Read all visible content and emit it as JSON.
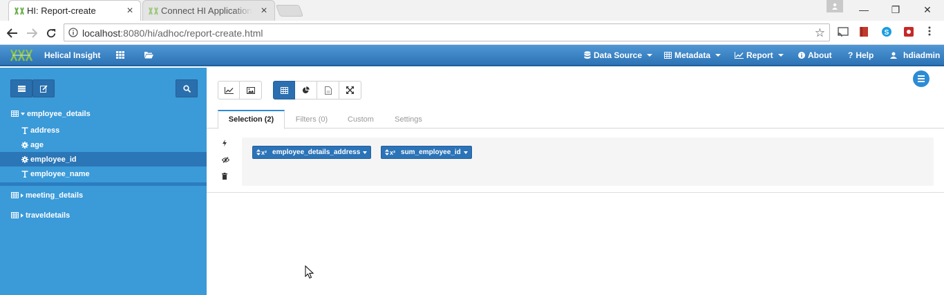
{
  "browser": {
    "tabs": [
      {
        "title": "HI: Report-create",
        "active": true
      },
      {
        "title": "Connect HI Application w",
        "active": false
      }
    ],
    "url_host": "localhost",
    "url_rest": ":8080/hi/adhoc/report-create.html",
    "controls": {
      "minimize": "—",
      "restore": "❐",
      "close": "✕"
    }
  },
  "appbar": {
    "brand": "Helical Insight",
    "menu": [
      {
        "label": "Data Source",
        "icon": "database-icon",
        "dropdown": true
      },
      {
        "label": "Metadata",
        "icon": "table-icon",
        "dropdown": true
      },
      {
        "label": "Report",
        "icon": "line-chart-icon",
        "dropdown": true
      },
      {
        "label": "About",
        "icon": "info-icon",
        "dropdown": false
      },
      {
        "label": "Help",
        "icon": "question-icon",
        "dropdown": false
      },
      {
        "label": "hdiadmin",
        "icon": "user-icon",
        "dropdown": false
      }
    ]
  },
  "sidebar": {
    "tables": [
      {
        "name": "employee_details",
        "expanded": true,
        "columns": [
          {
            "name": "address",
            "type": "text",
            "selected": false
          },
          {
            "name": "age",
            "type": "numeric",
            "selected": false
          },
          {
            "name": "employee_id",
            "type": "numeric",
            "selected": true
          },
          {
            "name": "employee_name",
            "type": "text",
            "selected": false
          }
        ]
      },
      {
        "name": "meeting_details",
        "expanded": false,
        "columns": []
      },
      {
        "name": "traveldetails",
        "expanded": false,
        "columns": []
      }
    ]
  },
  "main": {
    "tabs": [
      {
        "label": "Selection (2)",
        "active": true
      },
      {
        "label": "Filters (0)",
        "active": false
      },
      {
        "label": "Custom",
        "active": false
      },
      {
        "label": "Settings",
        "active": false
      }
    ],
    "fields": [
      {
        "prefix": "x²",
        "label": "employee_details_address"
      },
      {
        "prefix": "x²",
        "label": "sum_employee_id"
      }
    ]
  },
  "colors": {
    "appbar": "#3a86c8",
    "sidebar": "#3b9ad8",
    "chip": "#2c74b8",
    "accent": "#2d8bd5"
  }
}
